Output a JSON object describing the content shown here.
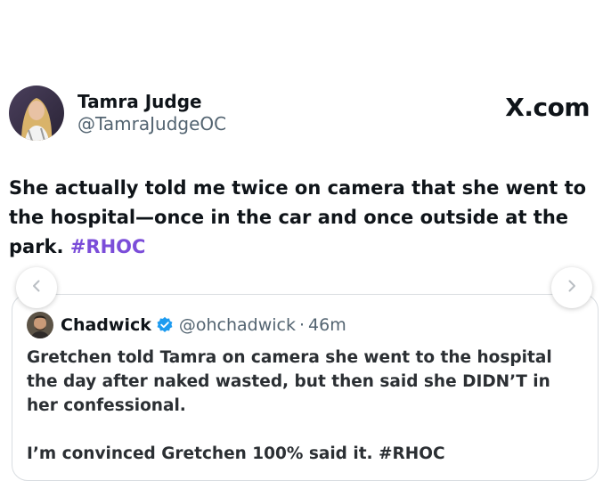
{
  "post": {
    "author": {
      "display_name": "Tamra Judge",
      "handle": "@TamraJudgeOC",
      "avatar": "profile-photo-woman"
    },
    "site": "X.com",
    "text": "She actually told me twice on camera that she went to the hospital—once in the car and once outside at the park.",
    "hashtag": "#RHOC"
  },
  "quoted_post": {
    "display_name": "Chadwick",
    "verified_icon": "verified-badge-icon",
    "handle": "@ohchadwick",
    "separator": "·",
    "time": "46m",
    "paragraph_1": "Gretchen told Tamra on camera she went to the hospital the day after naked wasted, but then said she DIDN’T in her confessional.",
    "paragraph_2": "I’m convinced Gretchen 100% said it. #RHOC"
  },
  "navigation": {
    "prev_icon": "chevron-left-icon",
    "next_icon": "chevron-right-icon"
  },
  "colors": {
    "hashtag": "#7b4dd9",
    "verified": "#1d9bf0",
    "secondary_text": "#536471",
    "border": "#d9dde1"
  }
}
